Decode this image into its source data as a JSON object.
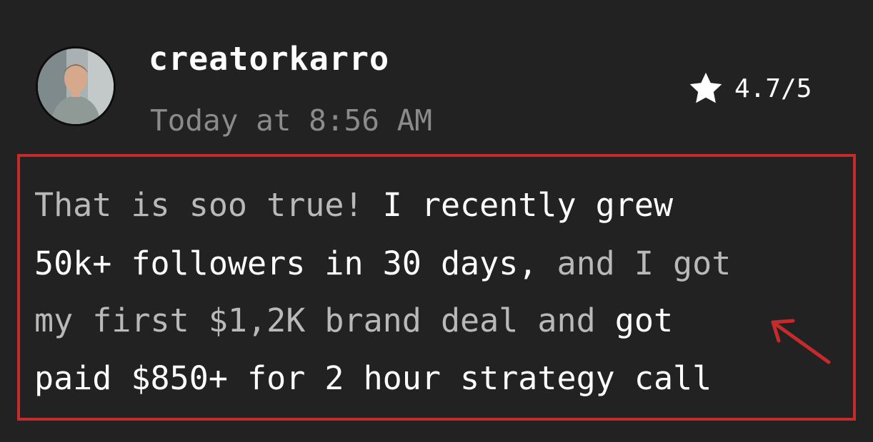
{
  "post": {
    "username": "creatorkarro",
    "timestamp": "Today at 8:56 AM",
    "rating": "4.7/5",
    "avatar_icon": "profile-photo",
    "rating_icon": "star-icon"
  },
  "comment": {
    "highlight_color": "#c62b2b",
    "lines": [
      {
        "dim": "That is soo true! ",
        "bright": "I recently grew"
      },
      {
        "bright": "50k+ followers in 30 days, ",
        "dim": "and I got"
      },
      {
        "dim": "my first $1,2K brand deal and ",
        "bright": "got"
      },
      {
        "bright": "paid $850+ for 2 hour strategy call"
      }
    ]
  }
}
